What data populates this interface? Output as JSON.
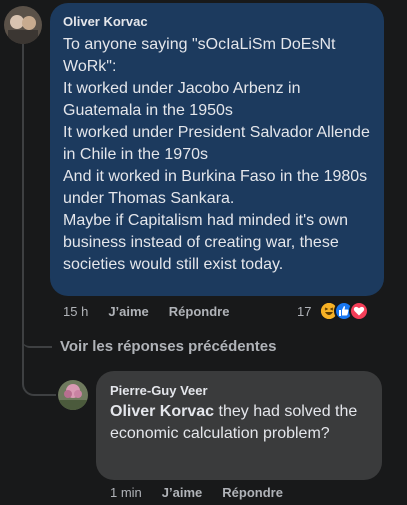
{
  "comment": {
    "author": "Oliver Korvac",
    "text": "To anyone saying \"sOcIaLiSm DoEsNt WoRk\":\nIt worked under Jacobo Arbenz in Guatemala in the 1950s\nIt worked under President Salvador Allende in Chile in the 1970s\nAnd it worked in Burkina Faso in the 1980s under Thomas Sankara.\nMaybe if Capitalism had minded it's own business instead of creating war, these societies would still exist today.",
    "time": "15 h",
    "like_label": "J’aime",
    "reply_label": "Répondre",
    "reaction_count": "17",
    "reaction_icons": [
      "haha-icon",
      "like-icon",
      "love-icon"
    ]
  },
  "view_replies_label": "Voir les réponses précédentes",
  "reply": {
    "author": "Pierre-Guy Veer",
    "mention": "Oliver Korvac",
    "text": " they had solved the economic calculation problem?",
    "time": "1 min",
    "like_label": "J’aime",
    "reply_label": "Répondre"
  },
  "colors": {
    "bubble_main": "#1c3a5e",
    "bubble_reply": "#3a3b3c",
    "background": "#18191a"
  }
}
